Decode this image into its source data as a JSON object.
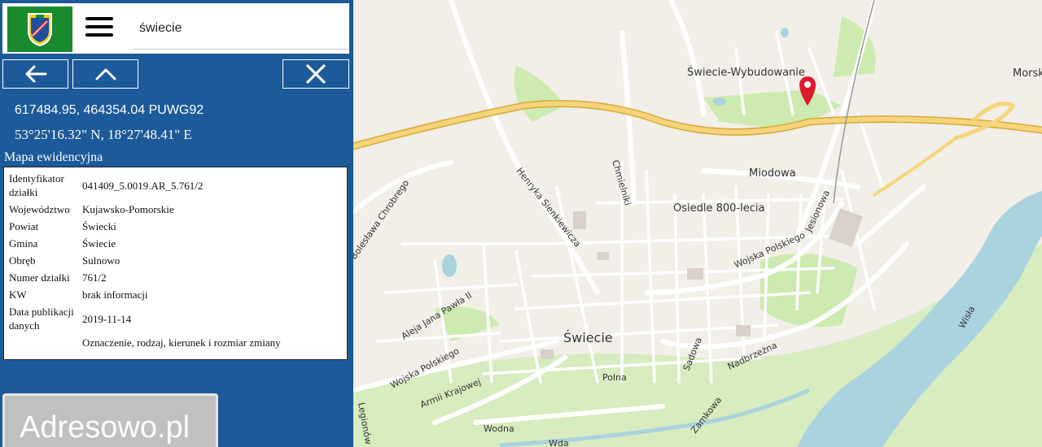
{
  "app": {
    "logo": "coat-of-arms-icon",
    "menu_icon": "hamburger-menu-icon",
    "search": {
      "value": "świecie",
      "placeholder": ""
    }
  },
  "nav": {
    "back_icon": "arrow-left-icon",
    "up_icon": "chevron-up-icon",
    "close_icon": "close-icon"
  },
  "coordinates": {
    "puwg": "617484.95, 464354.04 PUWG92",
    "geo": "53°25'16.32\" N, 18°27'48.41\" E"
  },
  "parcel": {
    "title": "Mapa ewidencyjna",
    "rows": [
      {
        "key": "Identyfikator działki",
        "value": "041409_5.0019.AR_5.761/2"
      },
      {
        "key": "Województwo",
        "value": "Kujawsko-Pomorskie"
      },
      {
        "key": "Powiat",
        "value": "Świecki"
      },
      {
        "key": "Gmina",
        "value": "Świecie"
      },
      {
        "key": "Obręb",
        "value": "Sulnowo"
      },
      {
        "key": "Numer działki",
        "value": "761/2"
      },
      {
        "key": "KW",
        "value": "brak informacji"
      },
      {
        "key": "Data publikacji danych",
        "value": "2019-11-14"
      },
      {
        "key": "",
        "value": "Oznaczenie, rodzaj, kierunek i rozmiar zmiany"
      }
    ]
  },
  "watermark": {
    "text": "Adresowo.pl"
  },
  "map": {
    "marker_icon": "map-pin-icon",
    "labels": {
      "wybudowanie": "Świecie-Wybudowanie",
      "morsk": "Morsk",
      "miodowa": "Miodowa",
      "osiedle": "Osiedle 800-lecia",
      "chmielniki": "Chmielniki",
      "sienkiewicza": "Henryka Sienkiewicza",
      "chrobrego": "Bolesława Chrobrego",
      "jesionowa": "Jesionowa",
      "wojska_polskiego_1": "Wojska Polskiego",
      "aleja": "Aleja Jana Pawła II",
      "swiecie": "Świecie",
      "wojska_polskiego_2": "Wojska Polskiego",
      "sadowa": "Sadowa",
      "nadbrzezna": "Nadbrzeżna",
      "armii": "Armii Krajowej",
      "polna": "Polna",
      "zamkowa": "Zamkowa",
      "wodna": "Wodna",
      "wda": "Wda",
      "wisla": "Wisła",
      "legionow": "Legionów"
    },
    "colors": {
      "land": "#f2efe9",
      "water": "#aad3df",
      "green": "#cdebb0",
      "motorway": "#f7d47a",
      "road": "#ffffff",
      "marker": "#e0182d"
    }
  }
}
